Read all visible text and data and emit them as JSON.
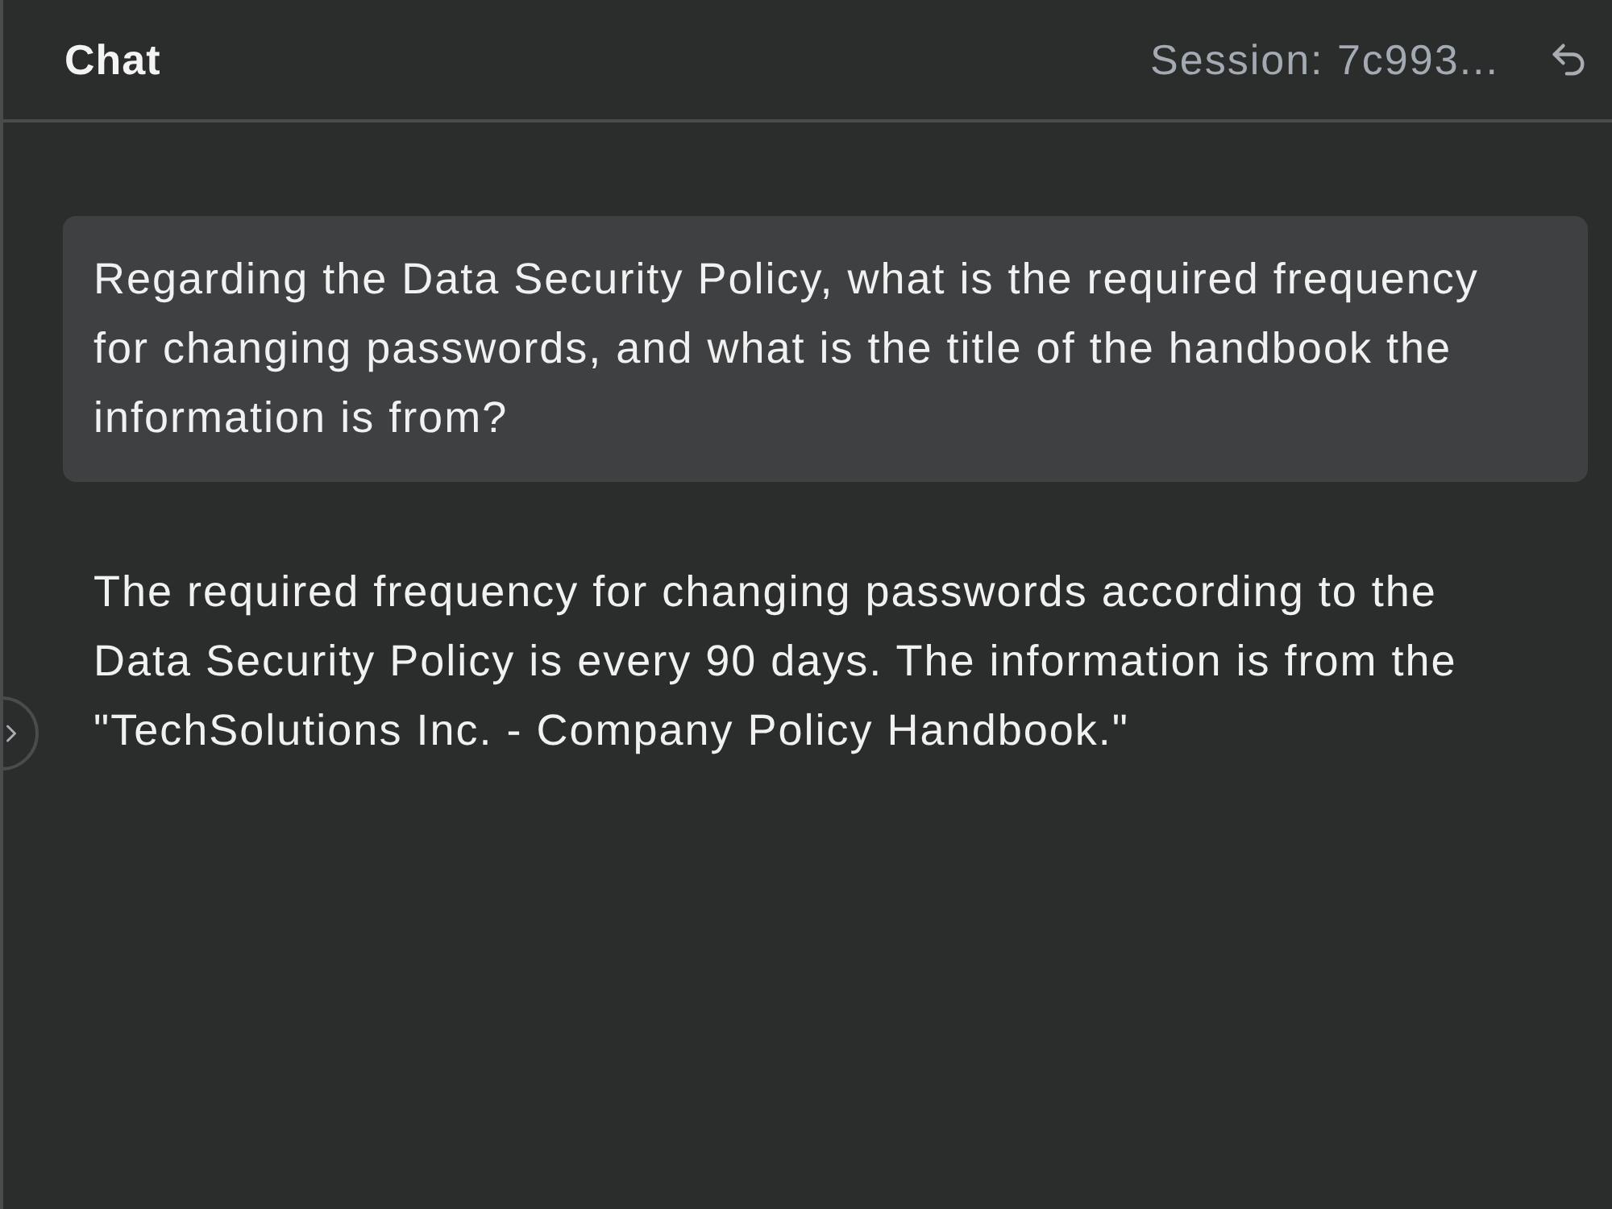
{
  "header": {
    "title": "Chat",
    "session": "Session: 7c993..."
  },
  "messages": [
    {
      "kind": "user",
      "text": "Regarding the Data Security Policy, what is the required frequency for changing passwords, and what is the title of the handbook the information is from?"
    },
    {
      "kind": "assistant",
      "text": "The required frequency for changing passwords according to the Data Security Policy is every 90 days. The information is from the \"TechSolutions Inc. - Company Policy Handbook.\""
    }
  ]
}
